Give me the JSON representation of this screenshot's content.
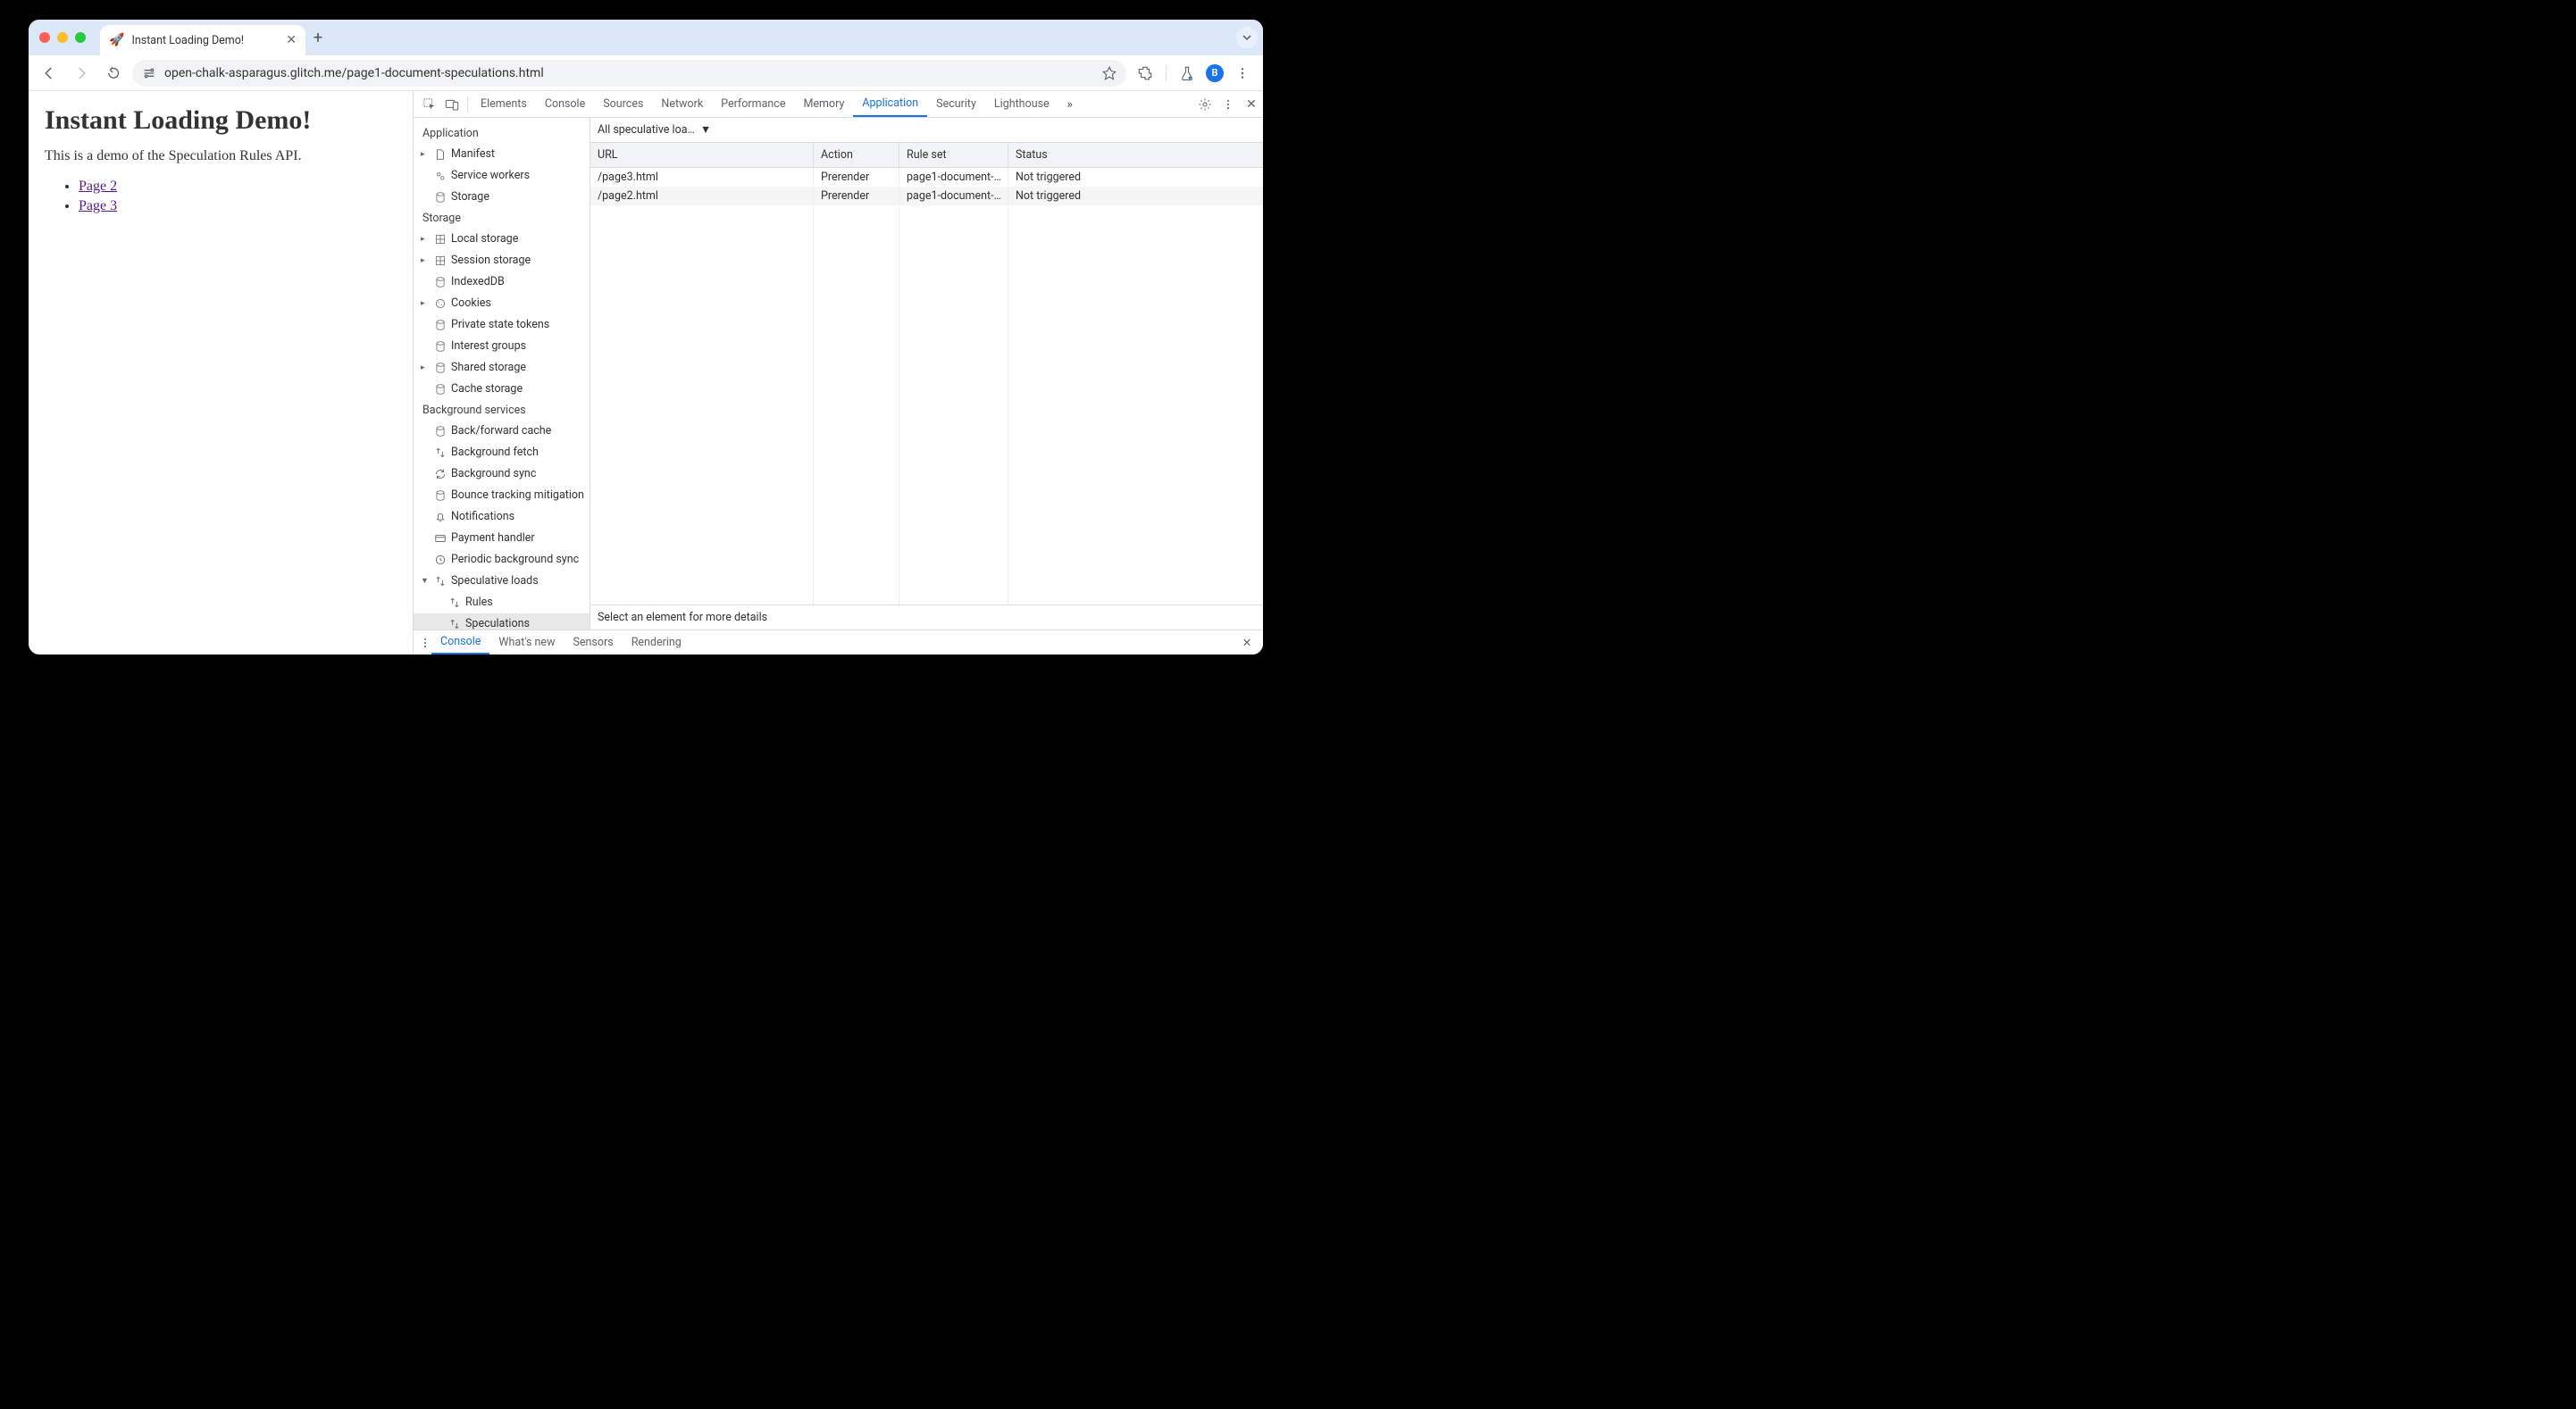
{
  "tab": {
    "title": "Instant Loading Demo!",
    "favicon": "🚀"
  },
  "url": "open-chalk-asparagus.glitch.me/page1-document-speculations.html",
  "avatar_letter": "B",
  "page": {
    "heading": "Instant Loading Demo!",
    "intro": "This is a demo of the Speculation Rules API.",
    "links": [
      "Page 2",
      "Page 3"
    ]
  },
  "devtools": {
    "tabs": [
      "Elements",
      "Console",
      "Sources",
      "Network",
      "Performance",
      "Memory",
      "Application",
      "Security",
      "Lighthouse"
    ],
    "active_tab": "Application",
    "sidebar": {
      "groups": [
        {
          "title": "Application",
          "items": [
            {
              "label": "Manifest",
              "icon": "file",
              "arrow": true
            },
            {
              "label": "Service workers",
              "icon": "gears"
            },
            {
              "label": "Storage",
              "icon": "db"
            }
          ]
        },
        {
          "title": "Storage",
          "items": [
            {
              "label": "Local storage",
              "icon": "grid",
              "arrow": true
            },
            {
              "label": "Session storage",
              "icon": "grid",
              "arrow": true
            },
            {
              "label": "IndexedDB",
              "icon": "db"
            },
            {
              "label": "Cookies",
              "icon": "cookie",
              "arrow": true
            },
            {
              "label": "Private state tokens",
              "icon": "db"
            },
            {
              "label": "Interest groups",
              "icon": "db"
            },
            {
              "label": "Shared storage",
              "icon": "db",
              "arrow": true
            },
            {
              "label": "Cache storage",
              "icon": "db"
            }
          ]
        },
        {
          "title": "Background services",
          "items": [
            {
              "label": "Back/forward cache",
              "icon": "db"
            },
            {
              "label": "Background fetch",
              "icon": "arrows"
            },
            {
              "label": "Background sync",
              "icon": "sync"
            },
            {
              "label": "Bounce tracking mitigation",
              "icon": "db"
            },
            {
              "label": "Notifications",
              "icon": "bell"
            },
            {
              "label": "Payment handler",
              "icon": "card"
            },
            {
              "label": "Periodic background sync",
              "icon": "clock"
            },
            {
              "label": "Speculative loads",
              "icon": "arrows",
              "arrow": true,
              "expanded": true,
              "children": [
                {
                  "label": "Rules",
                  "icon": "arrows"
                },
                {
                  "label": "Speculations",
                  "icon": "arrows",
                  "selected": true
                }
              ]
            }
          ]
        }
      ]
    },
    "filter_label": "All speculative loa…",
    "table": {
      "headers": [
        "URL",
        "Action",
        "Rule set",
        "Status"
      ],
      "rows": [
        {
          "url": "/page3.html",
          "action": "Prerender",
          "ruleset": "page1-document-…",
          "status": "Not triggered"
        },
        {
          "url": "/page2.html",
          "action": "Prerender",
          "ruleset": "page1-document-…",
          "status": "Not triggered"
        }
      ]
    },
    "detail_placeholder": "Select an element for more details",
    "drawer_tabs": [
      "Console",
      "What's new",
      "Sensors",
      "Rendering"
    ],
    "drawer_active": "Console"
  }
}
